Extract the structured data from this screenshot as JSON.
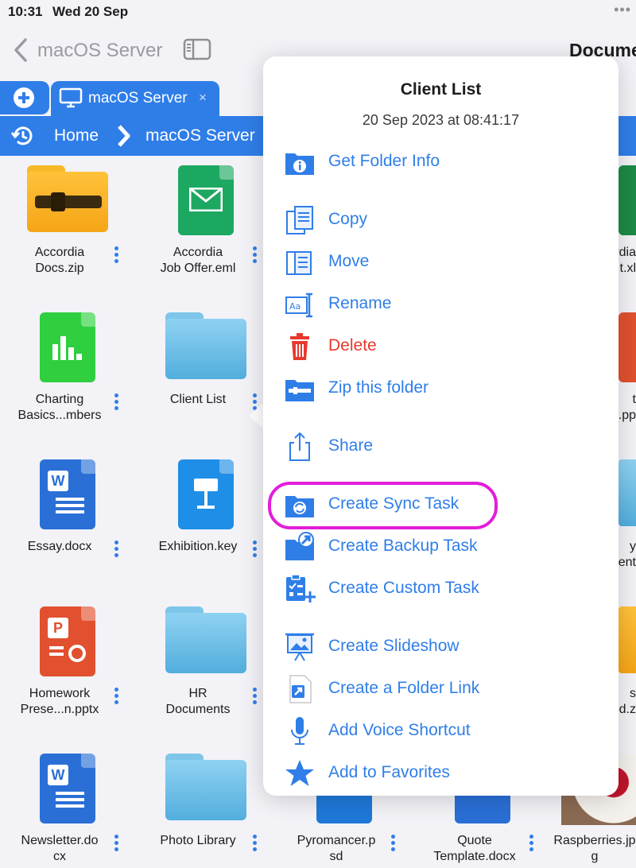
{
  "status_bar": {
    "time": "10:31",
    "date": "Wed 20 Sep",
    "more": "•••"
  },
  "navbar": {
    "back_label": "macOS Server",
    "title": "Docume"
  },
  "tabs": {
    "active_label": "macOS Server",
    "close": "×"
  },
  "breadcrumb": {
    "home": "Home",
    "server": "macOS Server"
  },
  "files": [
    {
      "name": "Accordia Docs.zip",
      "type": "zip"
    },
    {
      "name": "Accordia Job Offer.eml",
      "type": "eml"
    },
    {
      "name": "Charting Basics...mbers",
      "type": "numbers"
    },
    {
      "name": "Client List",
      "type": "folder"
    },
    {
      "name": "Essay.docx",
      "type": "docx"
    },
    {
      "name": "Exhibition.key",
      "type": "key"
    },
    {
      "name": "Homework Prese...n.pptx",
      "type": "pptx"
    },
    {
      "name": "HR Documents",
      "type": "folder"
    },
    {
      "name": "Newsletter.docx",
      "type": "docx"
    },
    {
      "name": "Photo Library",
      "type": "folder"
    },
    {
      "name": "Pyromancer.psd",
      "type": "psd"
    },
    {
      "name": "Quote Template.docx",
      "type": "docx"
    },
    {
      "name": "Raspberries.jpg",
      "type": "jpg"
    }
  ],
  "file_labels": {
    "accordia_docs_l1": "Accordia",
    "accordia_docs_l2": "Docs.zip",
    "accordia_job_l1": "Accordia",
    "accordia_job_l2": "Job Offer.eml",
    "charting_l1": "Charting",
    "charting_l2": "Basics...mbers",
    "client_list": "Client List",
    "essay": "Essay.docx",
    "exhibition": "Exhibition.key",
    "homework_l1": "Homework",
    "homework_l2": "Prese...n.pptx",
    "hr_l1": "HR",
    "hr_l2": "Documents",
    "newsletter_l1": "Newsletter.do",
    "newsletter_l2": "cx",
    "photo_library": "Photo Library",
    "pyromancer_l1": "Pyromancer.p",
    "pyromancer_l2": "sd",
    "quote_l1": "Quote",
    "quote_l2": "Template.docx",
    "raspberries_l1": "Raspberries.jp",
    "raspberries_l2": "g",
    "right_col_1a": "rdia",
    "right_col_1b": "t.xl",
    "right_col_2a": "t",
    "right_col_2b": ".pp",
    "right_col_3a": "y",
    "right_col_3b": "ent",
    "right_col_4a": "s",
    "right_col_4b": "d.z"
  },
  "popover": {
    "title": "Client List",
    "date": "20 Sep 2023 at 08:41:17",
    "items": [
      {
        "label": "Get Folder Info",
        "icon": "folder-info-icon"
      },
      {
        "label": "Copy",
        "icon": "copy-icon"
      },
      {
        "label": "Move",
        "icon": "move-icon"
      },
      {
        "label": "Rename",
        "icon": "rename-icon"
      },
      {
        "label": "Delete",
        "icon": "trash-icon"
      },
      {
        "label": "Zip this folder",
        "icon": "zip-folder-icon"
      },
      {
        "label": "Share",
        "icon": "share-icon"
      },
      {
        "label": "Create Sync Task",
        "icon": "sync-folder-icon"
      },
      {
        "label": "Create Backup Task",
        "icon": "backup-icon"
      },
      {
        "label": "Create Custom Task",
        "icon": "custom-task-icon"
      },
      {
        "label": "Create Slideshow",
        "icon": "slideshow-icon"
      },
      {
        "label": "Create a Folder Link",
        "icon": "folder-link-icon"
      },
      {
        "label": "Add Voice Shortcut",
        "icon": "microphone-icon"
      },
      {
        "label": "Add to Favorites",
        "icon": "star-icon"
      }
    ]
  },
  "colors": {
    "accent": "#2f7ee8",
    "danger": "#e8392e",
    "highlight": "#e21ed9"
  }
}
